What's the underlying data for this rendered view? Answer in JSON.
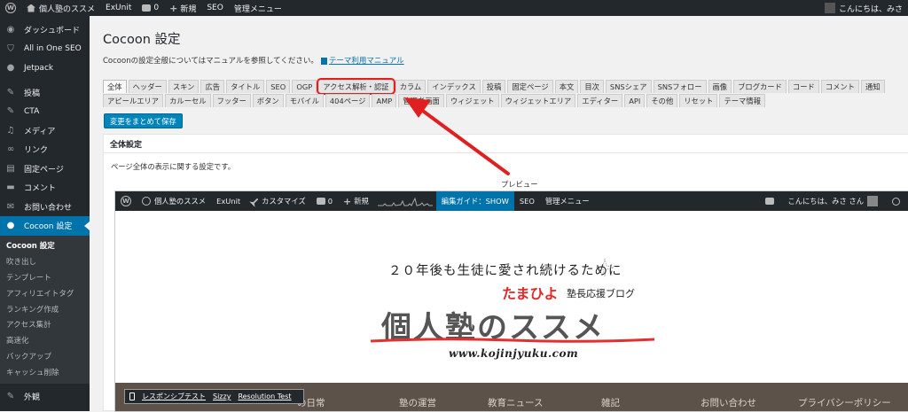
{
  "adminbar": {
    "site_name": "個人塾のススメ",
    "items": [
      "ExUnit",
      "0",
      "新規",
      "SEO",
      "管理メニュー"
    ],
    "greeting": "こんにちは、みさ"
  },
  "sidebar": {
    "items": [
      {
        "label": "ダッシュボード",
        "icon": "dashboard-icon"
      },
      {
        "label": "All in One SEO",
        "icon": "shield-icon"
      },
      {
        "label": "Jetpack",
        "icon": "jetpack-icon"
      },
      {
        "label": "投稿",
        "icon": "pin-icon"
      },
      {
        "label": "CTA",
        "icon": "pin-icon"
      },
      {
        "label": "メディア",
        "icon": "media-icon"
      },
      {
        "label": "リンク",
        "icon": "link-icon"
      },
      {
        "label": "固定ページ",
        "icon": "page-icon"
      },
      {
        "label": "コメント",
        "icon": "comment-icon"
      },
      {
        "label": "お問い合わせ",
        "icon": "mail-icon"
      },
      {
        "label": "Cocoon 設定",
        "icon": "cocoon-icon"
      }
    ],
    "submenu": [
      "Cocoon 設定",
      "吹き出し",
      "テンプレート",
      "アフィリエイトタグ",
      "ランキング作成",
      "アクセス集計",
      "高速化",
      "バックアップ",
      "キャッシュ削除"
    ],
    "bottom_item": {
      "label": "外観",
      "icon": "appearance-icon"
    }
  },
  "page": {
    "title": "Cocoon 設定",
    "desc": "Cocoonの設定全般についてはマニュアルを参照してください。",
    "manual_link": "テーマ利用マニュアル"
  },
  "tabs": {
    "row1": [
      "全体",
      "ヘッダー",
      "スキン",
      "広告",
      "タイトル",
      "SEO",
      "OGP",
      "アクセス解析・認証",
      "カラム",
      "インデックス",
      "投稿",
      "固定ページ",
      "本文",
      "目次",
      "SNSシェア",
      "SNSフォロー",
      "画像",
      "ブログカード",
      "コード",
      "コメント",
      "通知"
    ],
    "row2": [
      "アピールエリア",
      "カルーセル",
      "フッター",
      "ボタン",
      "モバイル",
      "404ページ",
      "AMP",
      "管理者画面",
      "ウィジェット",
      "ウィジェットエリア",
      "エディター",
      "API",
      "その他",
      "リセット",
      "テーマ情報"
    ]
  },
  "save_button": "変更をまとめて保存",
  "panel": {
    "title": "全体設定",
    "desc": "ページ全体の表示に関する設定です。",
    "preview_label": "プレビュー"
  },
  "preview": {
    "bar_items": [
      "個人塾のススメ",
      "ExUnit",
      "カスタマイズ",
      "0",
      "新規"
    ],
    "edit_guide": "編集ガイド：SHOW",
    "bar_items2": [
      "SEO",
      "管理メニュー"
    ],
    "greeting": "こんにちは、みさ さん",
    "logo_tagline": "２０年後も生徒に愛され続けるために",
    "logo_tamahiyo": "たまひよ",
    "logo_sub": "塾長応援ブログ",
    "logo_main": "個人塾のススメ",
    "logo_url": "www.kojinjyuku.com",
    "nav": [
      "の日常",
      "塾の運営",
      "教育ニュース",
      "雑記",
      "お問い合わせ",
      "プライバシーポリシー"
    ],
    "resp_links": [
      "レスポンシブテスト",
      "Sizzy",
      "Resolution Test"
    ]
  },
  "colors": {
    "admin_dark": "#23282d",
    "accent_blue": "#0073aa",
    "highlight_red": "#e02020"
  }
}
